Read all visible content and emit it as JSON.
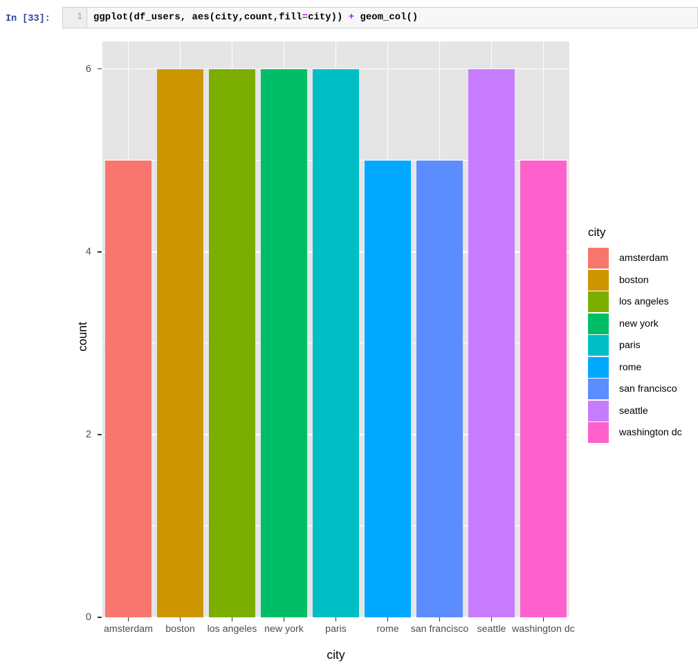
{
  "notebook": {
    "prompt": "In [33]:",
    "line_number": "1",
    "code_segments": [
      {
        "text": "ggplot(df_users, aes(city,count,fill",
        "type": "plain"
      },
      {
        "text": "=",
        "type": "operator"
      },
      {
        "text": "city)) ",
        "type": "plain"
      },
      {
        "text": "+",
        "type": "operator"
      },
      {
        "text": " geom_col()",
        "type": "plain"
      }
    ],
    "code_full": "ggplot(df_users, aes(city,count,fill=city)) + geom_col()"
  },
  "chart_data": {
    "type": "bar",
    "title": "",
    "xlabel": "city",
    "ylabel": "count",
    "categories": [
      "amsterdam",
      "boston",
      "los angeles",
      "new york",
      "paris",
      "rome",
      "san francisco",
      "seattle",
      "washington dc"
    ],
    "values": [
      5,
      6,
      6,
      6,
      6,
      5,
      5,
      6,
      5
    ],
    "colors": [
      "#F8766D",
      "#CD9600",
      "#7CAE00",
      "#00BE67",
      "#00BFC4",
      "#00A9FF",
      "#5B8DFF",
      "#C77CFF",
      "#FF61CC"
    ],
    "ylim": [
      0,
      6.3
    ],
    "ytick_labels": [
      "0",
      "2",
      "4",
      "6"
    ],
    "ytick_values": [
      0,
      2,
      4,
      6
    ],
    "yminor_values": [
      1,
      3,
      5
    ],
    "grid": true,
    "legend": {
      "title": "city",
      "position": "right",
      "entries": [
        {
          "label": "amsterdam",
          "color": "#F8766D"
        },
        {
          "label": "boston",
          "color": "#CD9600"
        },
        {
          "label": "los angeles",
          "color": "#7CAE00"
        },
        {
          "label": "new york",
          "color": "#00BE67"
        },
        {
          "label": "paris",
          "color": "#00BFC4"
        },
        {
          "label": "rome",
          "color": "#00A9FF"
        },
        {
          "label": "san francisco",
          "color": "#5B8DFF"
        },
        {
          "label": "seattle",
          "color": "#C77CFF"
        },
        {
          "label": "washington dc",
          "color": "#FF61CC"
        }
      ]
    },
    "panel_background": "#E5E5E5",
    "grid_color": "#FFFFFF"
  }
}
